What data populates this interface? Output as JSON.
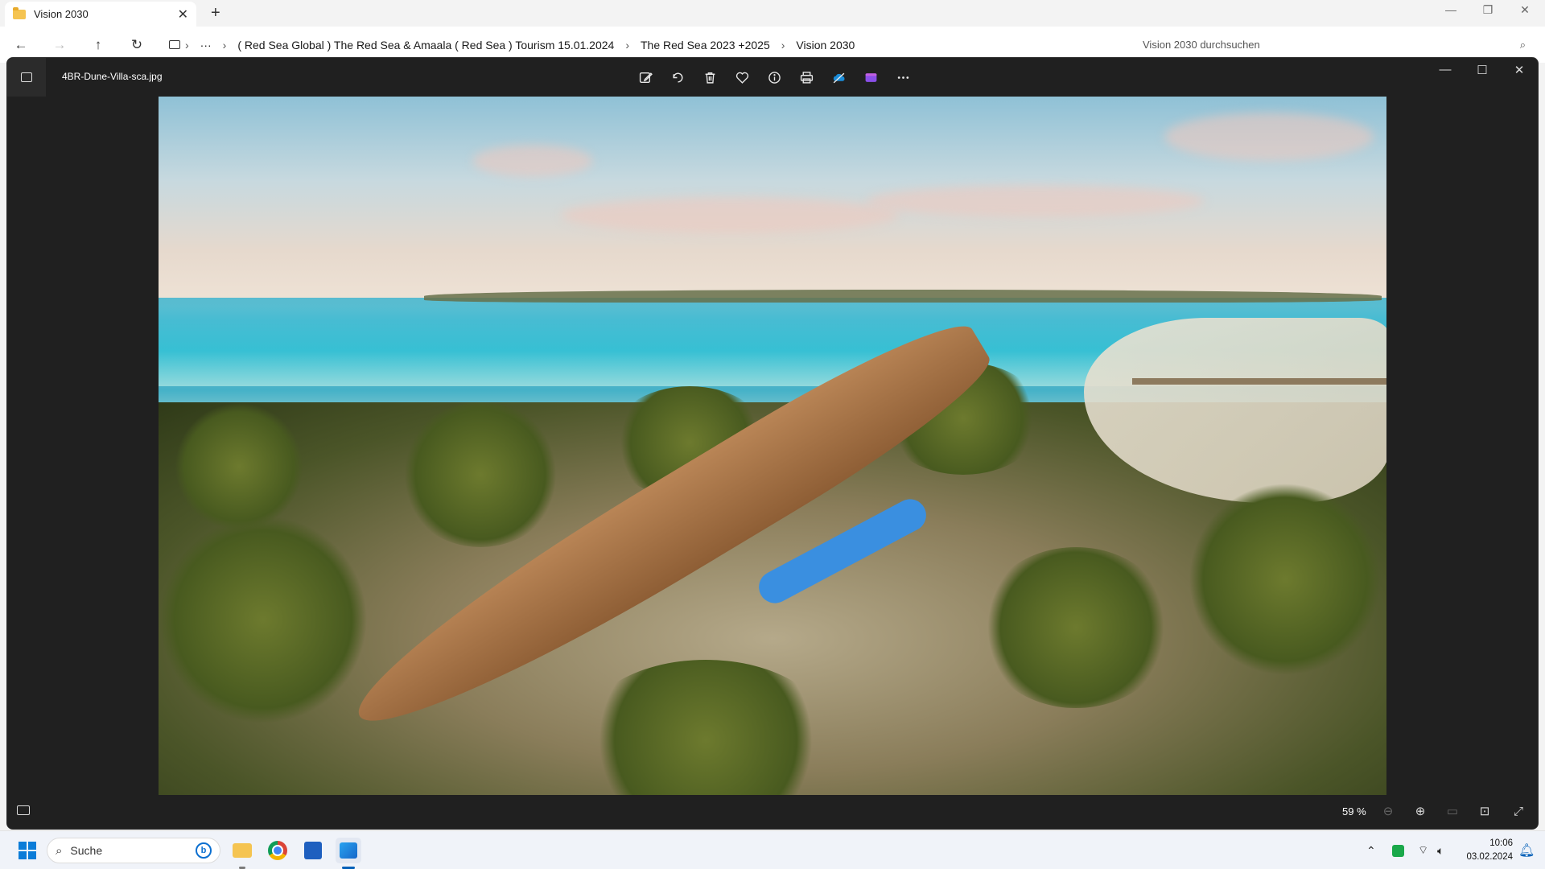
{
  "explorer": {
    "tab_title": "Vision 2030",
    "new_tab": "+",
    "breadcrumbs": [
      "( Red Sea Global ) The Red Sea & Amaala ( Red Sea ) Tourism 15.01.2024",
      "The Red Sea 2023 +2025",
      "Vision 2030"
    ],
    "more_label": "···",
    "search_placeholder": "Vision 2030 durchsuchen"
  },
  "viewer": {
    "filename": "4BR-Dune-Villa-sca.jpg",
    "zoom": "59 %",
    "tools": [
      "edit-image",
      "rotate",
      "delete",
      "favorite",
      "file-info",
      "print",
      "onedrive",
      "clipchamp",
      "more-options"
    ]
  },
  "taskbar": {
    "search_label": "Suche",
    "bing_label": "b",
    "time": "10:06",
    "date": "03.02.2024",
    "pinned": [
      "file-explorer",
      "chrome",
      "microsoft-store",
      "photos"
    ]
  },
  "colors": {
    "viewer_bg": "#202020",
    "accent": "#005fb8",
    "taskbar_bg": "#f0f3f9"
  }
}
